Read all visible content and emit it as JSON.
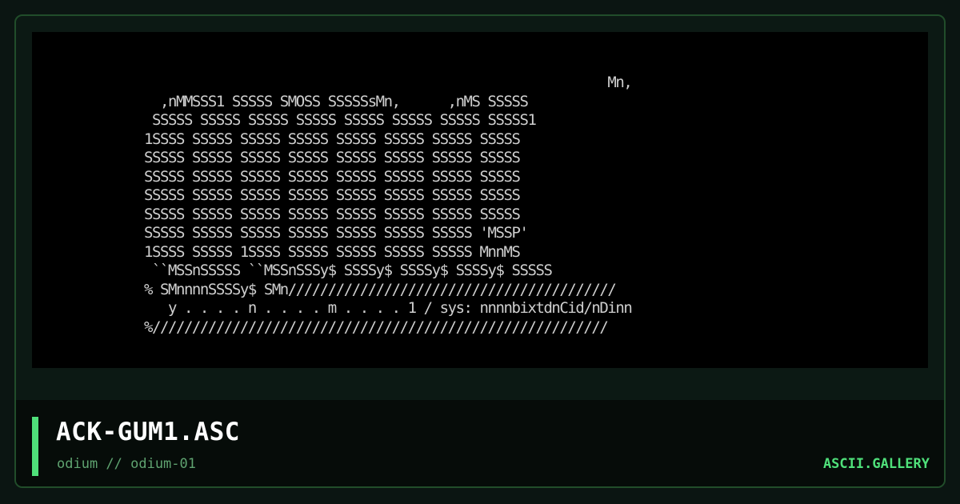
{
  "artwork": {
    "lines": [
      "                                                          Mn,",
      "  ,nMMSSS1 SSSSS SMOSS SSSSSsMn,      ,nMS SSSSS",
      " SSSSS SSSSS SSSSS SSSSS SSSSS SSSSS SSSSS SSSSS1",
      "1SSSS SSSSS SSSSS SSSSS SSSSS SSSSS SSSSS SSSSS",
      "SSSSS SSSSS SSSSS SSSSS SSSSS SSSSS SSSSS SSSSS",
      "SSSSS SSSSS SSSSS SSSSS SSSSS SSSSS SSSSS SSSSS",
      "SSSSS SSSSS SSSSS SSSSS SSSSS SSSSS SSSSS SSSSS",
      "SSSSS SSSSS SSSSS SSSSS SSSSS SSSSS SSSSS SSSSS",
      "SSSSS SSSSS SSSSS SSSSS SSSSS SSSSS SSSSS 'MSSP'",
      "1SSSS SSSSS 1SSSS SSSSS SSSSS SSSSS SSSSS MnnMS",
      " ``MSSnSSSSS ``MSSnSSSy$ SSSSy$ SSSSy$ SSSSy$ SSSSS",
      "% SMnnnnSSSSy$ SMn/////////////////////////////////////////",
      "   y . . . . n . . . . m . . . . 1 / sys: nnnnbixtdnCid/nDinn",
      "%/////////////////////////////////////////////////////////"
    ]
  },
  "footer": {
    "title": "ACK-GUM1.ASC",
    "subtitle": "odium // odium-01",
    "brand": "ASCII.GALLERY"
  },
  "colors": {
    "accent": "#4fe07a",
    "subtitle": "#5fa370",
    "art_text": "#cfcfcf",
    "art_background": "#000000",
    "card_border": "#214d2a"
  }
}
